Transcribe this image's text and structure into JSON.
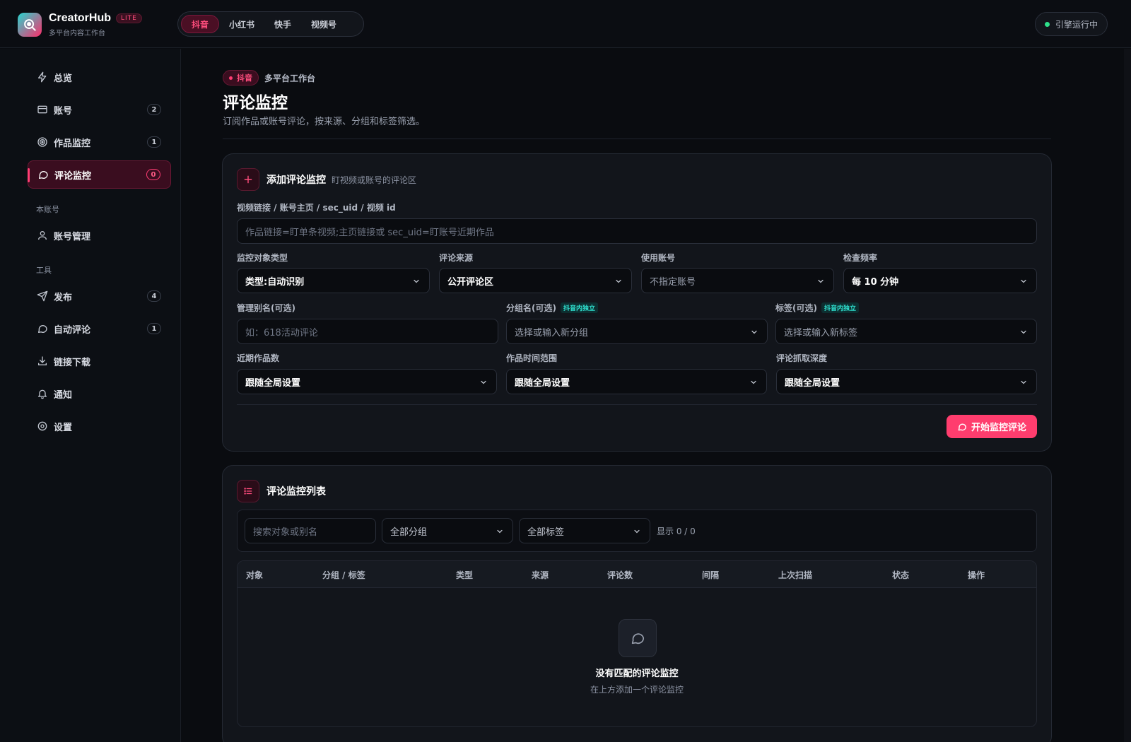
{
  "brand": {
    "name": "CreatorHub",
    "badge": "LITE",
    "subtitle": "多平台内容工作台"
  },
  "platforms": [
    {
      "label": "抖音",
      "active": true
    },
    {
      "label": "小红书",
      "active": false
    },
    {
      "label": "快手",
      "active": false
    },
    {
      "label": "视频号",
      "active": false
    }
  ],
  "engine_status": "引擎运行中",
  "sidebar": {
    "items": [
      {
        "label": "总览"
      },
      {
        "label": "账号",
        "count": "2"
      },
      {
        "label": "作品监控",
        "count": "1"
      },
      {
        "label": "评论监控",
        "count": "0"
      }
    ],
    "section_account": "本账号",
    "account_items": [
      {
        "label": "账号管理"
      }
    ],
    "section_tools": "工具",
    "tool_items": [
      {
        "label": "发布",
        "count": "4"
      },
      {
        "label": "自动评论",
        "count": "1"
      },
      {
        "label": "链接下载"
      },
      {
        "label": "通知"
      },
      {
        "label": "设置"
      }
    ]
  },
  "page": {
    "platform_tag": "抖音",
    "crumb": "多平台工作台",
    "title": "评论监控",
    "description": "订阅作品或账号评论，按来源、分组和标签筛选。"
  },
  "add_card": {
    "title": "添加评论监控",
    "subtitle": "盯视频或账号的评论区",
    "link_label": "视频链接 / 账号主页 / sec_uid / 视频 id",
    "link_placeholder": "作品链接=盯单条视频;主页链接或 sec_uid=盯账号近期作品",
    "target_type_label": "监控对象类型",
    "target_type_value": "类型:自动识别",
    "source_label": "评论来源",
    "source_value": "公开评论区",
    "account_label": "使用账号",
    "account_value": "不指定账号",
    "frequency_label": "检查频率",
    "frequency_value": "每 10 分钟",
    "alias_label": "管理别名(可选)",
    "alias_placeholder": "如：618活动评论",
    "group_label": "分组名(可选)",
    "group_tag": "抖音内独立",
    "group_placeholder": "选择或输入新分组",
    "tags_label": "标签(可选)",
    "tags_tag": "抖音内独立",
    "tags_placeholder": "选择或输入新标签",
    "recent_label": "近期作品数",
    "recent_value": "跟随全局设置",
    "range_label": "作品时间范围",
    "range_value": "跟随全局设置",
    "depth_label": "评论抓取深度",
    "depth_value": "跟随全局设置",
    "submit_label": "开始监控评论"
  },
  "list_card": {
    "title": "评论监控列表",
    "search_placeholder": "搜索对象或别名",
    "group_filter": "全部分组",
    "tag_filter": "全部标签",
    "display_count": "显示 0 / 0",
    "columns": [
      "对象",
      "分组 / 标签",
      "类型",
      "来源",
      "评论数",
      "间隔",
      "上次扫描",
      "状态",
      "操作"
    ],
    "empty_title": "没有匹配的评论监控",
    "empty_sub": "在上方添加一个评论监控"
  }
}
